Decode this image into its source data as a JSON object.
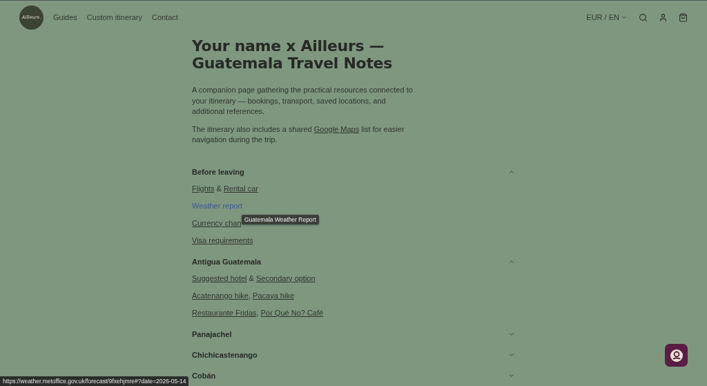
{
  "header": {
    "logo": "Ailleurs.",
    "nav": [
      "Guides",
      "Custom itinerary",
      "Contact"
    ],
    "locale": "EUR / EN"
  },
  "title": "Your name x Ailleurs — Guatemala Travel Notes",
  "intro": [
    "A companion page gathering the practical resources connected to your itinerary — bookings, transport, saved locations, and additional references."
  ],
  "maps_note": {
    "before": "The itinerary also includes a shared",
    "link": "Google Maps",
    "after": "list for easier navigation during the trip."
  },
  "sections": [
    {
      "title": "Before leaving",
      "expanded": true,
      "lines": [
        {
          "separator": "&",
          "links": [
            {
              "text": "Flights",
              "hovered": false
            },
            {
              "text": "Rental car",
              "hovered": false
            }
          ]
        },
        {
          "links": [
            {
              "text": "Weather report",
              "hovered": true
            }
          ]
        },
        {
          "links": [
            {
              "text": "Currency chan",
              "hovered": false
            }
          ],
          "tooltip": "Guatemala Weather Report"
        },
        {
          "links": [
            {
              "text": "Visa requirements",
              "hovered": false
            }
          ]
        }
      ]
    },
    {
      "title": "Antigua Guatemala",
      "expanded": true,
      "lines": [
        {
          "separator": "&",
          "links": [
            {
              "text": "Suggested hotel",
              "hovered": false
            },
            {
              "text": "Secondary option",
              "hovered": false
            }
          ]
        },
        {
          "separator": ",",
          "links": [
            {
              "text": "Acatenango hike",
              "hovered": false
            },
            {
              "text": "Pacaya hike",
              "hovered": false
            }
          ]
        },
        {
          "separator": ",",
          "links": [
            {
              "text": "Restaurante Fridas",
              "hovered": false
            },
            {
              "text": "Por Qué No? Café",
              "hovered": false
            }
          ]
        }
      ]
    },
    {
      "title": "Panajachel",
      "expanded": false
    },
    {
      "title": "Chichicastenango",
      "expanded": false
    },
    {
      "title": "Cobán",
      "expanded": false
    }
  ],
  "status_url": "https://weather.metoffice.gov.uk/forecast/9fxehjmre#?date=2026-05-14"
}
